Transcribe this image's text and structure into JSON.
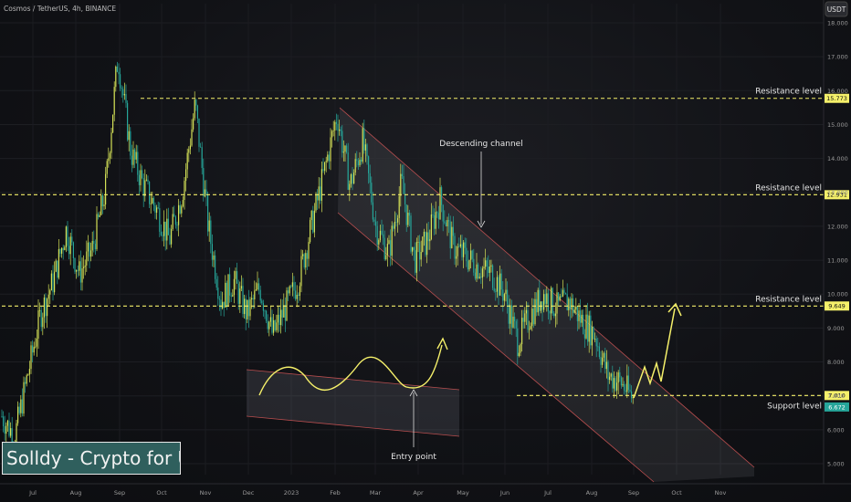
{
  "header": {
    "symbol": "Cosmos / TetherUS, 4h, BINANCE",
    "currency_badge": "USDT"
  },
  "brand": {
    "label": "Solldy - Crypto for U"
  },
  "colors": {
    "background": "#131417",
    "candle_up": "#d4e157",
    "candle_down": "#26a69a",
    "level_line": "#f5f06a",
    "channel_edge": "#e05a5a",
    "arrow": "#f5f06a"
  },
  "chart_data": {
    "type": "candlestick",
    "title": "Cosmos / TetherUS, 4h, BINANCE",
    "y_axis": {
      "min": 4.5,
      "max": 18.2,
      "ticks": [
        "18.000",
        "17.000",
        "16.000",
        "15.000",
        "14.000",
        "13.000",
        "12.000",
        "11.000",
        "10.000",
        "9.000",
        "8.000",
        "7.000",
        "6.000",
        "5.000"
      ]
    },
    "x_axis": {
      "ticks": [
        "Jul",
        "Aug",
        "Sep",
        "Oct",
        "Nov",
        "Dec",
        "2023",
        "Feb",
        "Mar",
        "Apr",
        "May",
        "Jun",
        "Jul",
        "Aug",
        "Sep",
        "Oct",
        "Nov"
      ]
    },
    "price_path": [
      [
        "Jul",
        6.4
      ],
      [
        "Jul",
        5.8
      ],
      [
        "Jul",
        7.6
      ],
      [
        "Jul",
        9.4
      ],
      [
        "Aug",
        10.4
      ],
      [
        "Aug",
        11.9
      ],
      [
        "Aug",
        10.6
      ],
      [
        "Sep",
        11.3
      ],
      [
        "Sep",
        13.0
      ],
      [
        "Sep",
        17.0
      ],
      [
        "Sep",
        14.2
      ],
      [
        "Oct",
        13.2
      ],
      [
        "Oct",
        12.5
      ],
      [
        "Oct",
        11.6
      ],
      [
        "Oct",
        13.0
      ],
      [
        "Nov",
        15.6
      ],
      [
        "Nov",
        12.0
      ],
      [
        "Nov",
        9.8
      ],
      [
        "Nov",
        10.4
      ],
      [
        "Dec",
        9.4
      ],
      [
        "Dec",
        10.2
      ],
      [
        "Dec",
        8.8
      ],
      [
        "Dec",
        9.6
      ],
      [
        "2023",
        10.4
      ],
      [
        "2023",
        12.0
      ],
      [
        "2023",
        13.6
      ],
      [
        "Feb",
        15.3
      ],
      [
        "Feb",
        13.2
      ],
      [
        "Feb",
        14.5
      ],
      [
        "Mar",
        12.0
      ],
      [
        "Mar",
        11.2
      ],
      [
        "Mar",
        13.3
      ],
      [
        "Mar",
        11.0
      ],
      [
        "Apr",
        11.6
      ],
      [
        "Apr",
        12.8
      ],
      [
        "Apr",
        11.4
      ],
      [
        "May",
        11.1
      ],
      [
        "May",
        10.8
      ],
      [
        "May",
        10.6
      ],
      [
        "Jun",
        10.0
      ],
      [
        "Jun",
        8.6
      ],
      [
        "Jun",
        9.4
      ],
      [
        "Jul",
        10.0
      ],
      [
        "Jul",
        9.6
      ],
      [
        "Jul",
        9.8
      ],
      [
        "Aug",
        9.2
      ],
      [
        "Aug",
        8.8
      ],
      [
        "Aug",
        7.6
      ],
      [
        "Sep",
        7.4
      ],
      [
        "Sep",
        6.9
      ]
    ],
    "levels": [
      {
        "label": "Resistance level",
        "value": 15.773,
        "badge": "15.773"
      },
      {
        "label": "Resistance level",
        "value": 12.931,
        "badge": "12.931"
      },
      {
        "label": "Resistance level",
        "value": 9.649,
        "badge": "9.649"
      },
      {
        "label": "Support level",
        "value": 7.01,
        "badge": "7.010"
      }
    ],
    "last_price": {
      "value": 6.672,
      "badge": "6.672"
    },
    "annotations": {
      "channel": "Descending channel",
      "entry": "Entry point"
    }
  }
}
